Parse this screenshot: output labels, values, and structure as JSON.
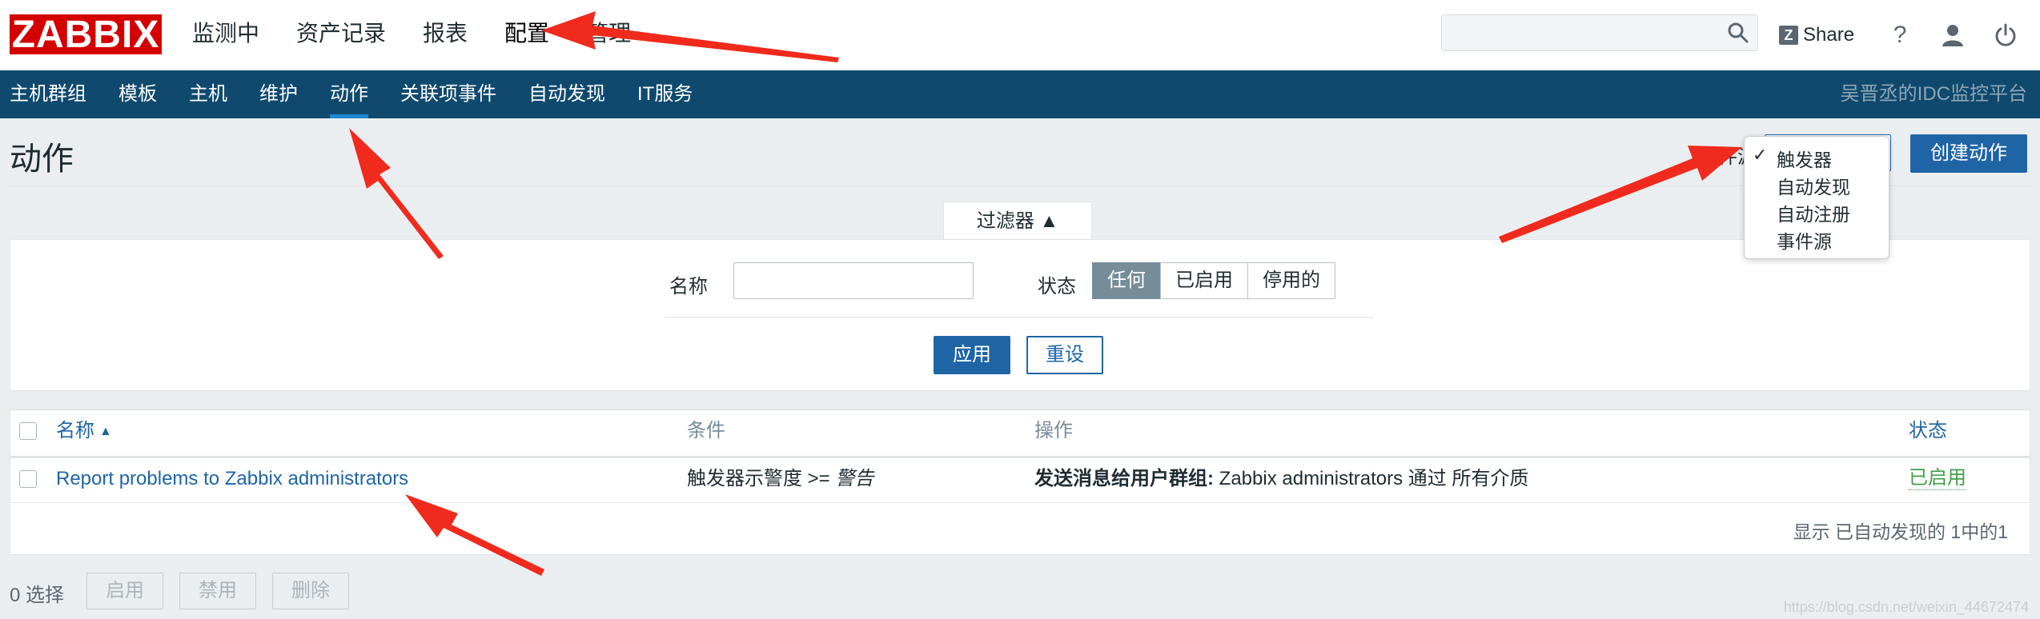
{
  "logo": "ZABBIX",
  "topnav": [
    "监测中",
    "资产记录",
    "报表",
    "配置",
    "管理"
  ],
  "topnav_active": 3,
  "header_tools": {
    "share": "Share",
    "help": "?"
  },
  "subnav": {
    "items": [
      "主机群组",
      "模板",
      "主机",
      "维护",
      "动作",
      "关联项事件",
      "自动发现",
      "IT服务"
    ],
    "active": 4,
    "brand": "吴晋丞的IDC监控平台"
  },
  "page": {
    "title": "动作",
    "event_source_label": "事件源",
    "create_button": "创建动作"
  },
  "event_source_dropdown": {
    "options": [
      "触发器",
      "自动发现",
      "自动注册",
      "事件源"
    ],
    "checked_mark": "✓"
  },
  "filter": {
    "tab_label": "过滤器 ▲",
    "name_label": "名称",
    "name_value": "",
    "status_label": "状态",
    "status_options": [
      "任何",
      "已启用",
      "停用的"
    ],
    "status_selected": 0,
    "apply": "应用",
    "reset": "重设"
  },
  "table": {
    "headers": {
      "name": "名称",
      "sort_arrow": "▲",
      "conditions": "条件",
      "operations": "操作",
      "status": "状态"
    },
    "rows": [
      {
        "name": "Report problems to Zabbix administrators",
        "condition_prefix": "触发器示警度 >= ",
        "condition_value": "警告",
        "op_bold": "发送消息给用户群组:",
        "op_rest": " Zabbix administrators 通过 所有介质",
        "status": "已启用"
      }
    ],
    "footer": "显示 已自动发现的 1中的1"
  },
  "bottom": {
    "selected": "0 选择",
    "buttons": [
      "启用",
      "禁用",
      "删除"
    ]
  },
  "watermark": "https://blog.csdn.net/weixin_44672474",
  "colors": {
    "brand_red": "#d40000",
    "subnav_bg": "#0f4a6e",
    "accent": "#1f65a6",
    "enabled": "#429e47",
    "arrow": "#f02a1c"
  }
}
